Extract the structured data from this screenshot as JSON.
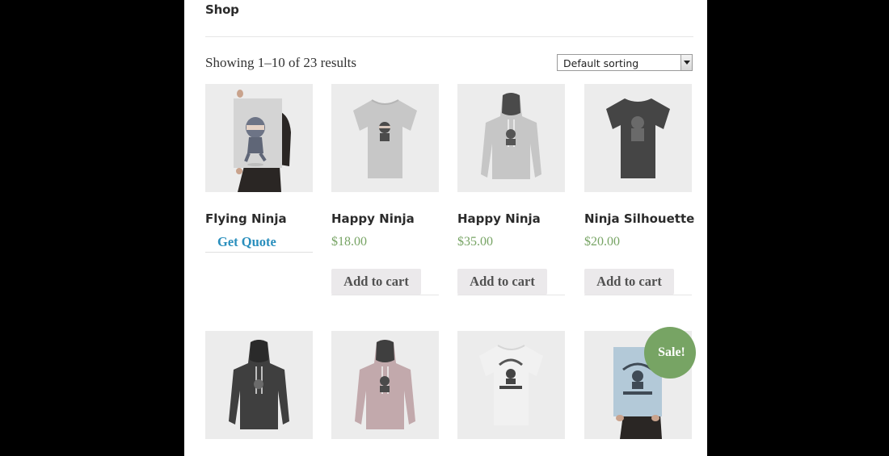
{
  "shop": {
    "title": "Shop",
    "result_count": "Showing 1–10 of 23 results",
    "sorting": {
      "selected": "Default sorting"
    }
  },
  "products": [
    {
      "title": "Flying Ninja",
      "action": "Get Quote",
      "image": "poster-flying-ninja"
    },
    {
      "title": "Happy Ninja",
      "price": "$18.00",
      "action": "Add to cart",
      "image": "tshirt-light"
    },
    {
      "title": "Happy Ninja",
      "price": "$35.00",
      "action": "Add to cart",
      "image": "hoodie-light"
    },
    {
      "title": "Ninja Silhouette",
      "price": "$20.00",
      "action": "Add to cart",
      "image": "tshirt-dark"
    }
  ],
  "row2": [
    {
      "image": "hoodie-dark"
    },
    {
      "image": "hoodie-pink"
    },
    {
      "image": "tshirt-woo-logo"
    },
    {
      "image": "poster-woo-logo",
      "badge": "Sale!"
    }
  ],
  "colors": {
    "background": "#000000",
    "page": "#ffffff",
    "price": "#77a464",
    "sale_badge": "#77a464",
    "quote_link": "#2a8fbd",
    "button": "#ebe9eb",
    "thumb_bg": "#ececec"
  }
}
